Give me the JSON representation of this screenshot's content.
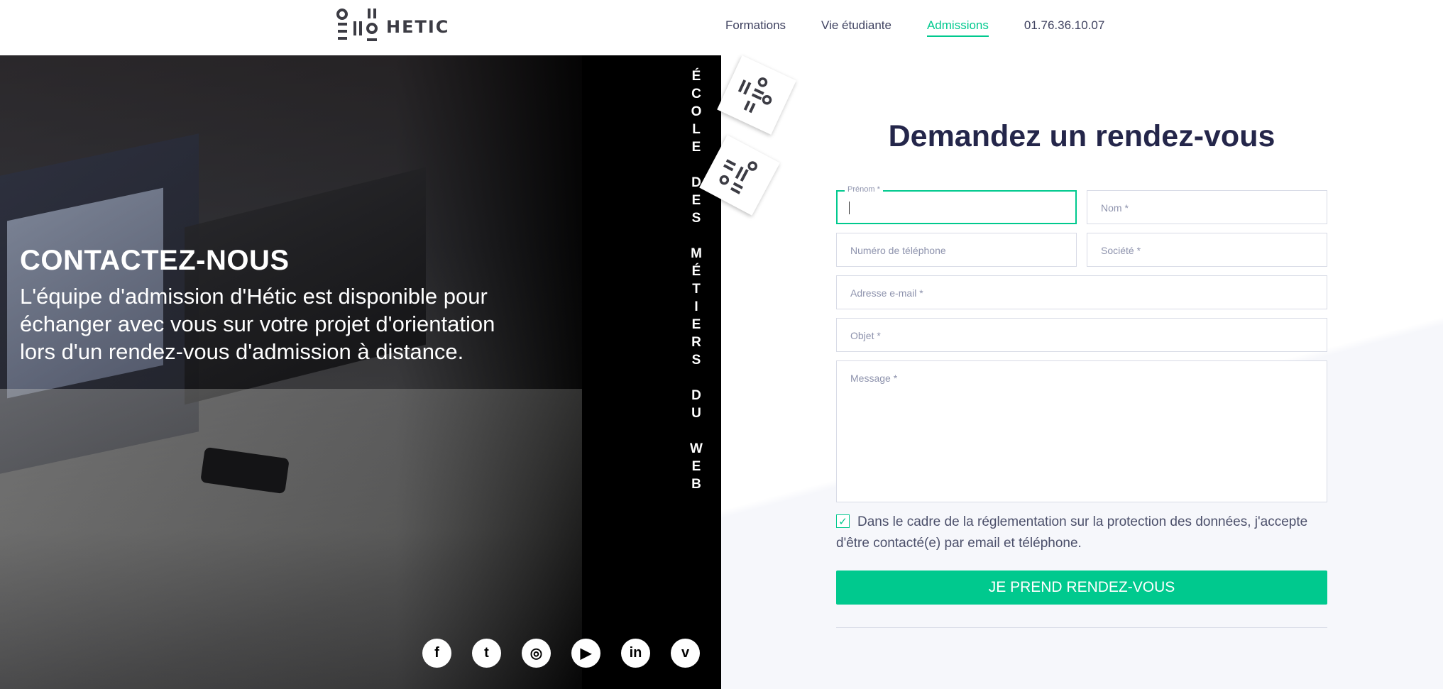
{
  "header": {
    "logo_text": "HETIC",
    "nav": [
      {
        "label": "Formations"
      },
      {
        "label": "Vie étudiante"
      },
      {
        "label": "Admissions"
      }
    ],
    "phone": "01.76.36.10.07",
    "accent_color": "#00c98e"
  },
  "hero": {
    "title": "CONTACTEZ-NOUS",
    "text": "L'équipe d'admission d'Hétic est disponible pour échanger avec vous sur votre projet d'orientation lors d'un rendez-vous d'admission à distance.",
    "vertical_text": [
      "É",
      "C",
      "O",
      "L",
      "E",
      "",
      "D",
      "E",
      "S",
      "",
      "M",
      "É",
      "T",
      "I",
      "E",
      "R",
      "S",
      "",
      "D",
      "U",
      "",
      "W",
      "E",
      "B"
    ],
    "socials": [
      {
        "icon": "facebook-icon",
        "glyph": "f"
      },
      {
        "icon": "twitter-icon",
        "glyph": "t"
      },
      {
        "icon": "instagram-icon",
        "glyph": "◎"
      },
      {
        "icon": "youtube-icon",
        "glyph": "▶"
      },
      {
        "icon": "linkedin-icon",
        "glyph": "in"
      },
      {
        "icon": "vimeo-icon",
        "glyph": "v"
      }
    ]
  },
  "form": {
    "title": "Demandez un rendez-vous",
    "prenom_label": "Prénom *",
    "nom_placeholder": "Nom *",
    "telephone_placeholder": "Numéro de téléphone",
    "societe_placeholder": "Société *",
    "email_placeholder": "Adresse e-mail *",
    "objet_placeholder": "Objet *",
    "message_placeholder": "Message *",
    "consent_checked": true,
    "consent_text": "Dans le cadre de la réglementation sur la protection des données, j'accepte d'être contacté(e) par email et téléphone.",
    "submit_label": "JE PREND RENDEZ-VOUS"
  }
}
